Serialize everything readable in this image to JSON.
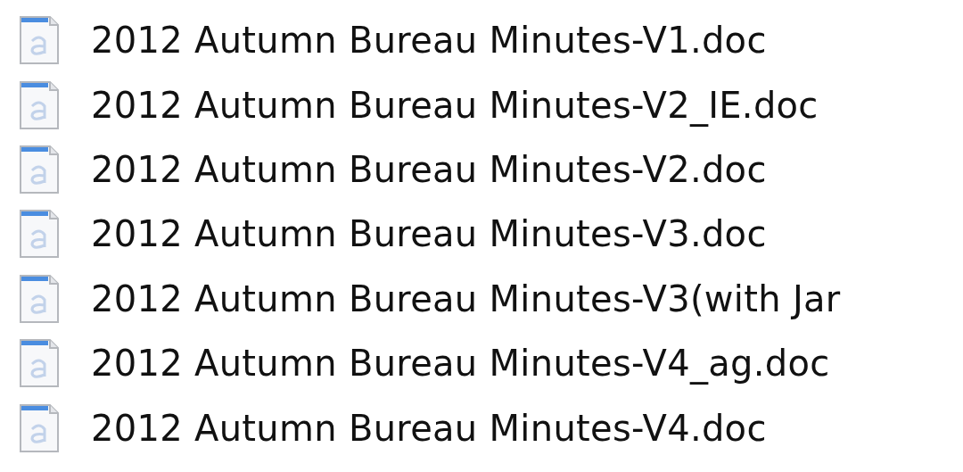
{
  "files": [
    {
      "name": "2012 Autumn Bureau Minutes-V1.doc"
    },
    {
      "name": "2012 Autumn Bureau Minutes-V2_IE.doc"
    },
    {
      "name": "2012 Autumn Bureau Minutes-V2.doc"
    },
    {
      "name": "2012 Autumn Bureau Minutes-V3.doc"
    },
    {
      "name": "2012 Autumn Bureau Minutes-V3(with Jar"
    },
    {
      "name": "2012 Autumn Bureau Minutes-V4_ag.doc"
    },
    {
      "name": "2012 Autumn Bureau Minutes-V4.doc"
    }
  ]
}
